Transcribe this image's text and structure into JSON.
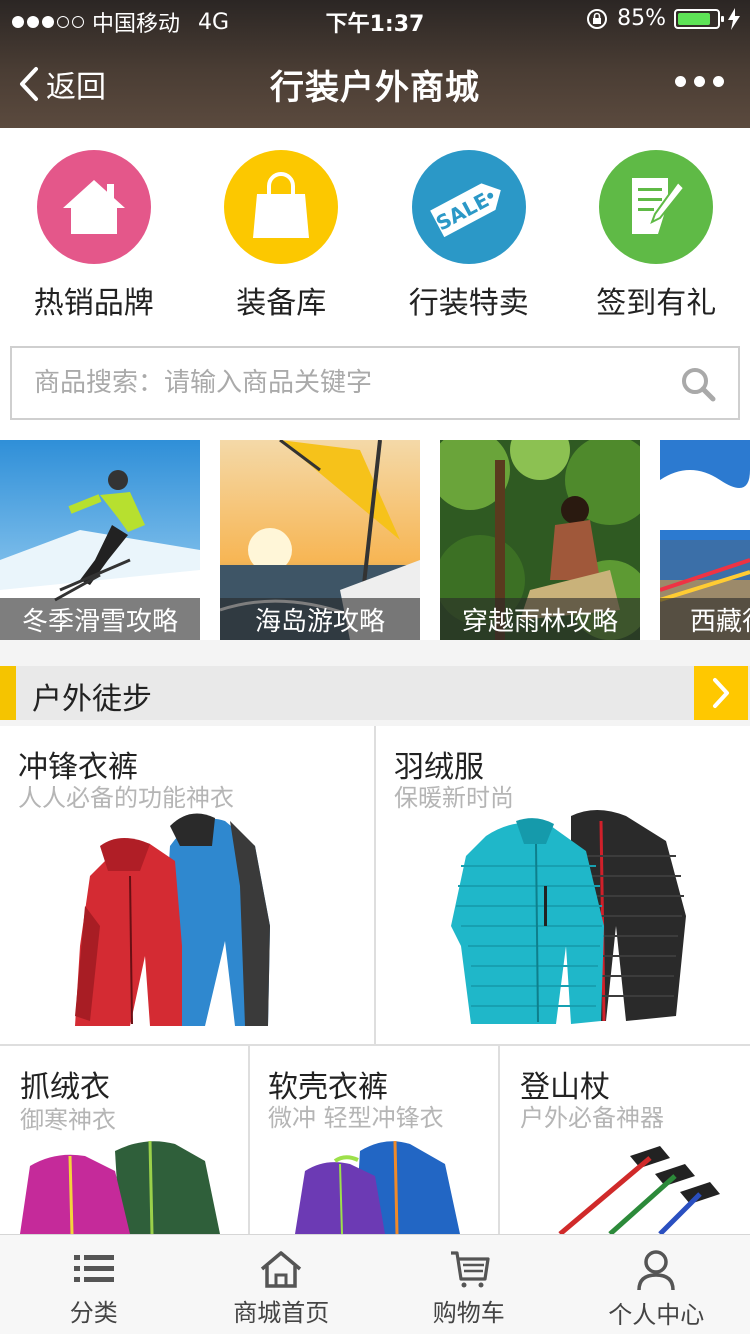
{
  "status": {
    "carrier": "中国移动",
    "network": "4G",
    "time": "下午1:37",
    "battery": "85%",
    "battery_level": 0.85
  },
  "nav": {
    "back_label": "返回",
    "title": "行装户外商城"
  },
  "quick_links": [
    {
      "label": "热销品牌",
      "icon": "house-icon",
      "color": "#e4578a"
    },
    {
      "label": "装备库",
      "icon": "shopping-bag-icon",
      "color": "#fcc800"
    },
    {
      "label": "行装特卖",
      "icon": "sale-tag-icon",
      "color": "#2b98c7"
    },
    {
      "label": "签到有礼",
      "icon": "note-pen-icon",
      "color": "#5fba46"
    }
  ],
  "search": {
    "placeholder": "商品搜索：请输入商品关键字"
  },
  "banners": [
    {
      "caption": "冬季滑雪攻略"
    },
    {
      "caption": "海岛游攻略"
    },
    {
      "caption": "穿越雨林攻略"
    },
    {
      "caption": "西藏行"
    }
  ],
  "section": {
    "title": "户外徒步"
  },
  "products": [
    {
      "name": "冲锋衣裤",
      "desc": "人人必备的功能神衣"
    },
    {
      "name": "羽绒服",
      "desc": "保暖新时尚"
    },
    {
      "name": "抓绒衣",
      "desc": "御寒神衣"
    },
    {
      "name": "软壳衣裤",
      "desc": "微冲 轻型冲锋衣"
    },
    {
      "name": "登山杖",
      "desc": "户外必备神器"
    }
  ],
  "tabs": [
    {
      "label": "分类",
      "icon": "list-icon"
    },
    {
      "label": "商城首页",
      "icon": "home-icon"
    },
    {
      "label": "购物车",
      "icon": "cart-icon"
    },
    {
      "label": "个人中心",
      "icon": "user-icon"
    }
  ],
  "colors": {
    "accent": "#ffc800",
    "header": "#3a312c"
  }
}
